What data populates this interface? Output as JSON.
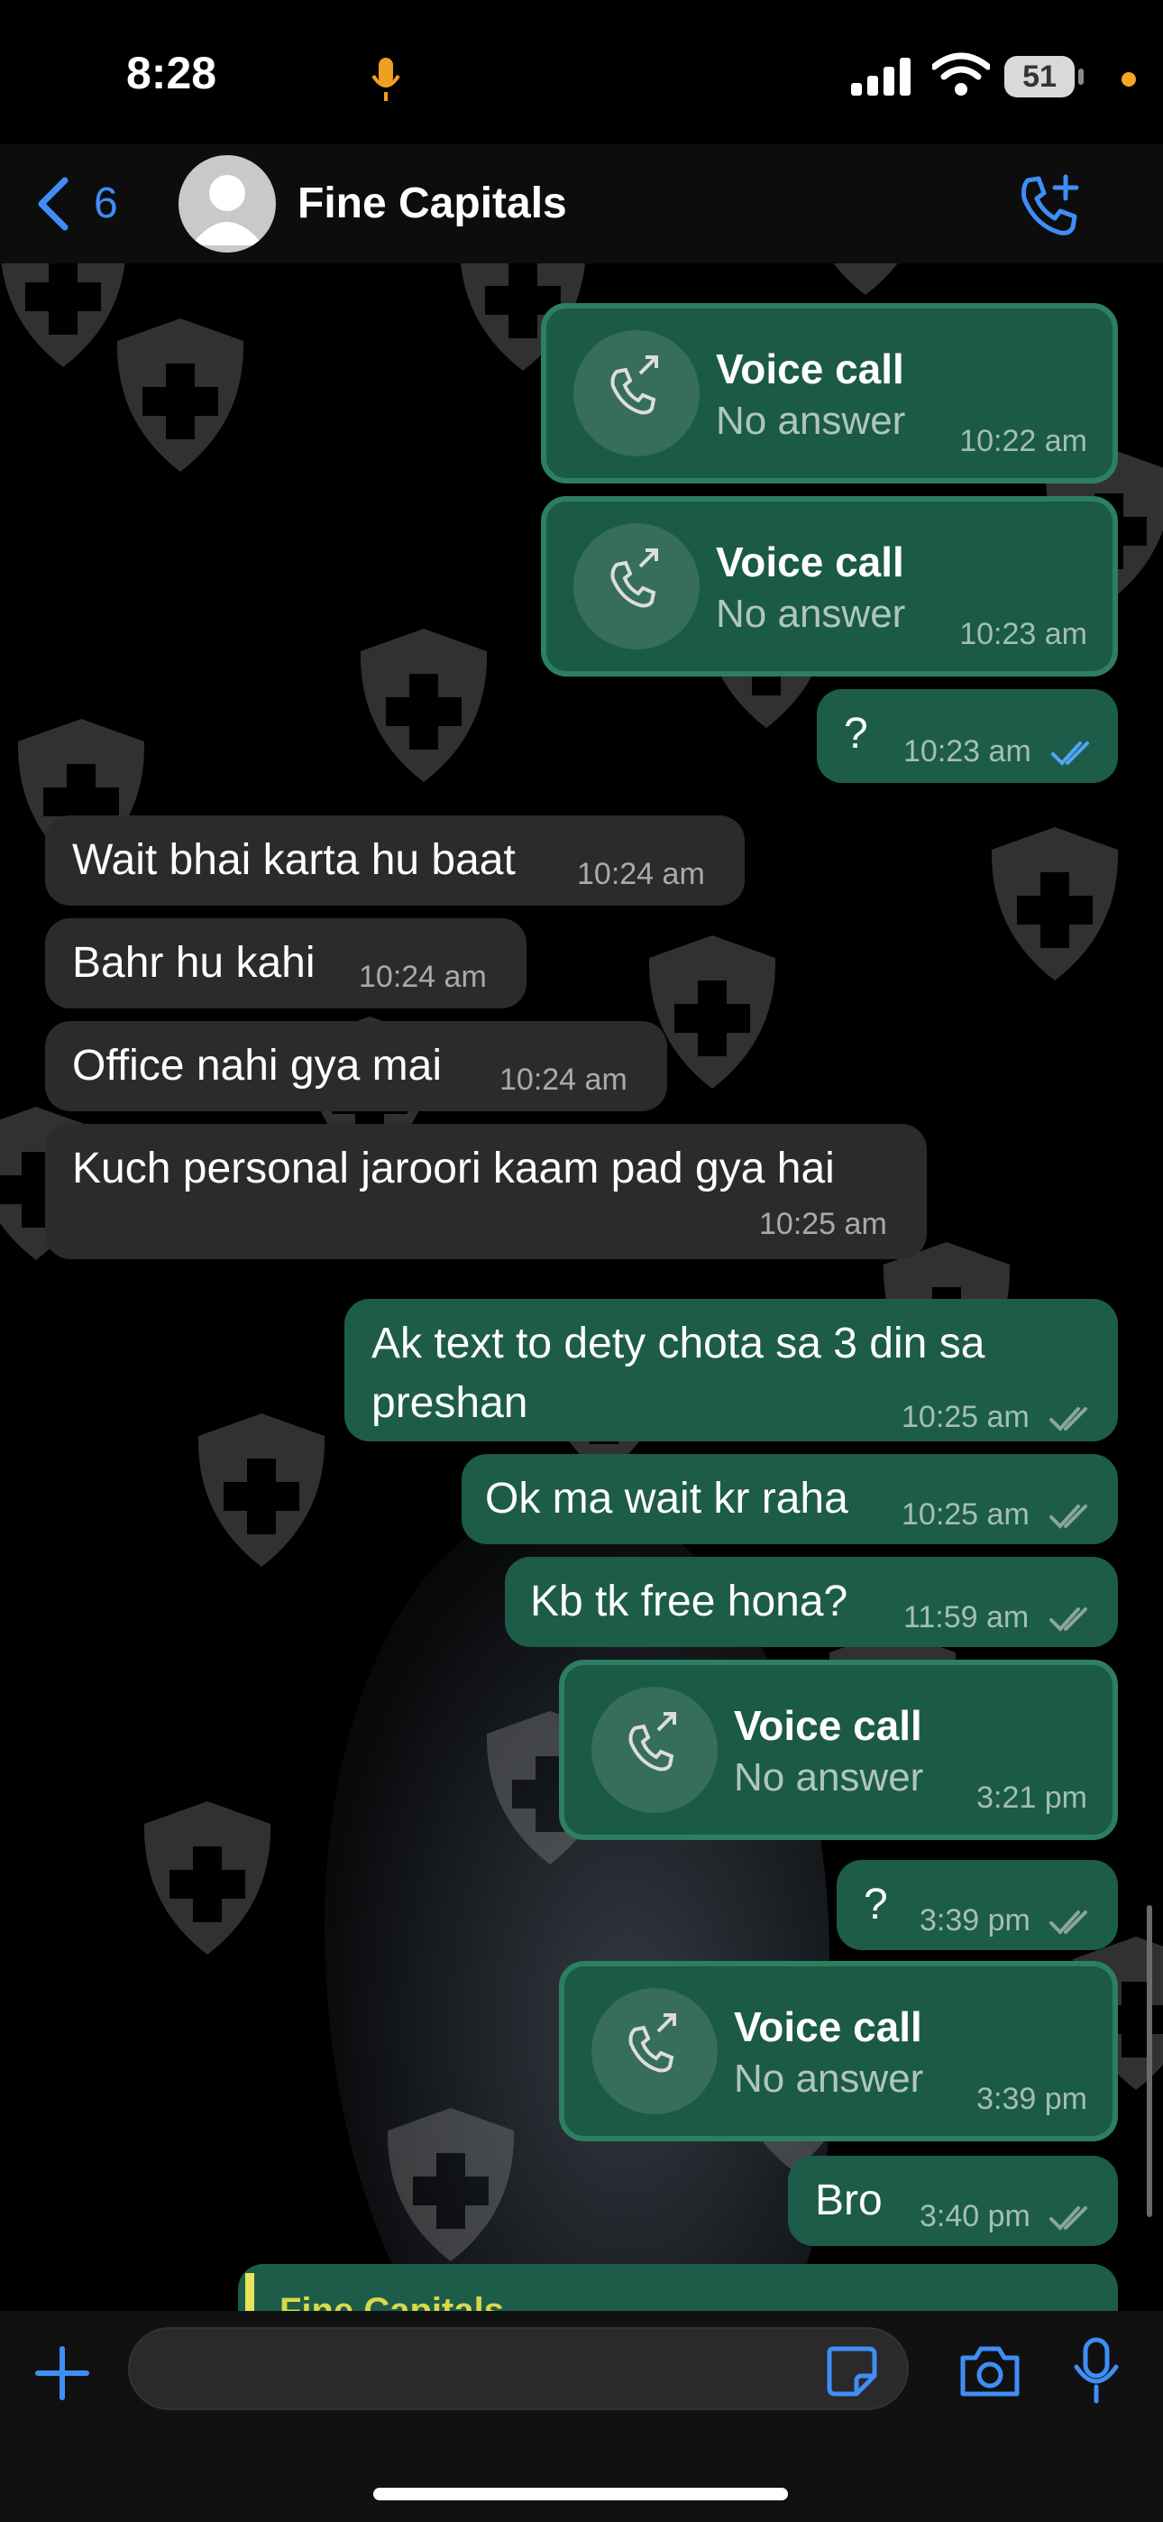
{
  "status_bar": {
    "time": "8:28",
    "battery": "51"
  },
  "header": {
    "back_count": "6",
    "contact_name": "Fine Capitals"
  },
  "messages": [
    {
      "type": "call",
      "direction": "out",
      "title": "Voice call",
      "subtitle": "No answer",
      "time": "10:22 am"
    },
    {
      "type": "call",
      "direction": "out",
      "title": "Voice call",
      "subtitle": "No answer",
      "time": "10:23 am"
    },
    {
      "type": "text",
      "direction": "out",
      "text": "?",
      "time": "10:23 am",
      "status": "read"
    },
    {
      "type": "text",
      "direction": "in",
      "text": "Wait bhai karta hu baat",
      "time": "10:24 am"
    },
    {
      "type": "text",
      "direction": "in",
      "text": "Bahr hu kahi",
      "time": "10:24 am"
    },
    {
      "type": "text",
      "direction": "in",
      "text": "Office nahi gya mai",
      "time": "10:24 am"
    },
    {
      "type": "text",
      "direction": "in",
      "text": "Kuch personal jaroori kaam pad gya hai",
      "time": "10:25 am"
    },
    {
      "type": "text",
      "direction": "out",
      "text_line1": "Ak text to dety chota sa 3 din sa",
      "text_line2": "preshan",
      "time": "10:25 am",
      "status": "delivered"
    },
    {
      "type": "text",
      "direction": "out",
      "text": "Ok ma wait kr raha",
      "time": "10:25 am",
      "status": "delivered"
    },
    {
      "type": "text",
      "direction": "out",
      "text": "Kb tk free hona?",
      "time": "11:59 am",
      "status": "delivered"
    },
    {
      "type": "call",
      "direction": "out",
      "title": "Voice call",
      "subtitle": "No answer",
      "time": "3:21 pm"
    },
    {
      "type": "text",
      "direction": "out",
      "text": "?",
      "time": "3:39 pm",
      "status": "delivered"
    },
    {
      "type": "call",
      "direction": "out",
      "title": "Voice call",
      "subtitle": "No answer",
      "time": "3:39 pm"
    },
    {
      "type": "text",
      "direction": "out",
      "text": "Bro",
      "time": "3:40 pm",
      "status": "delivered"
    }
  ],
  "quoted_preview": {
    "sender": "Fine Capitals"
  },
  "colors": {
    "accent": "#3f8ef7",
    "outgoing_bubble": "#1d5c48",
    "incoming_bubble": "#2b2b2b",
    "read_ticks": "#53a6f5"
  },
  "icons": {
    "back": "chevron-left-icon",
    "call_add": "phone-plus-icon",
    "call": "outgoing-call-icon",
    "plus": "plus-icon",
    "sticker": "sticker-icon",
    "camera": "camera-icon",
    "mic": "microphone-icon"
  }
}
